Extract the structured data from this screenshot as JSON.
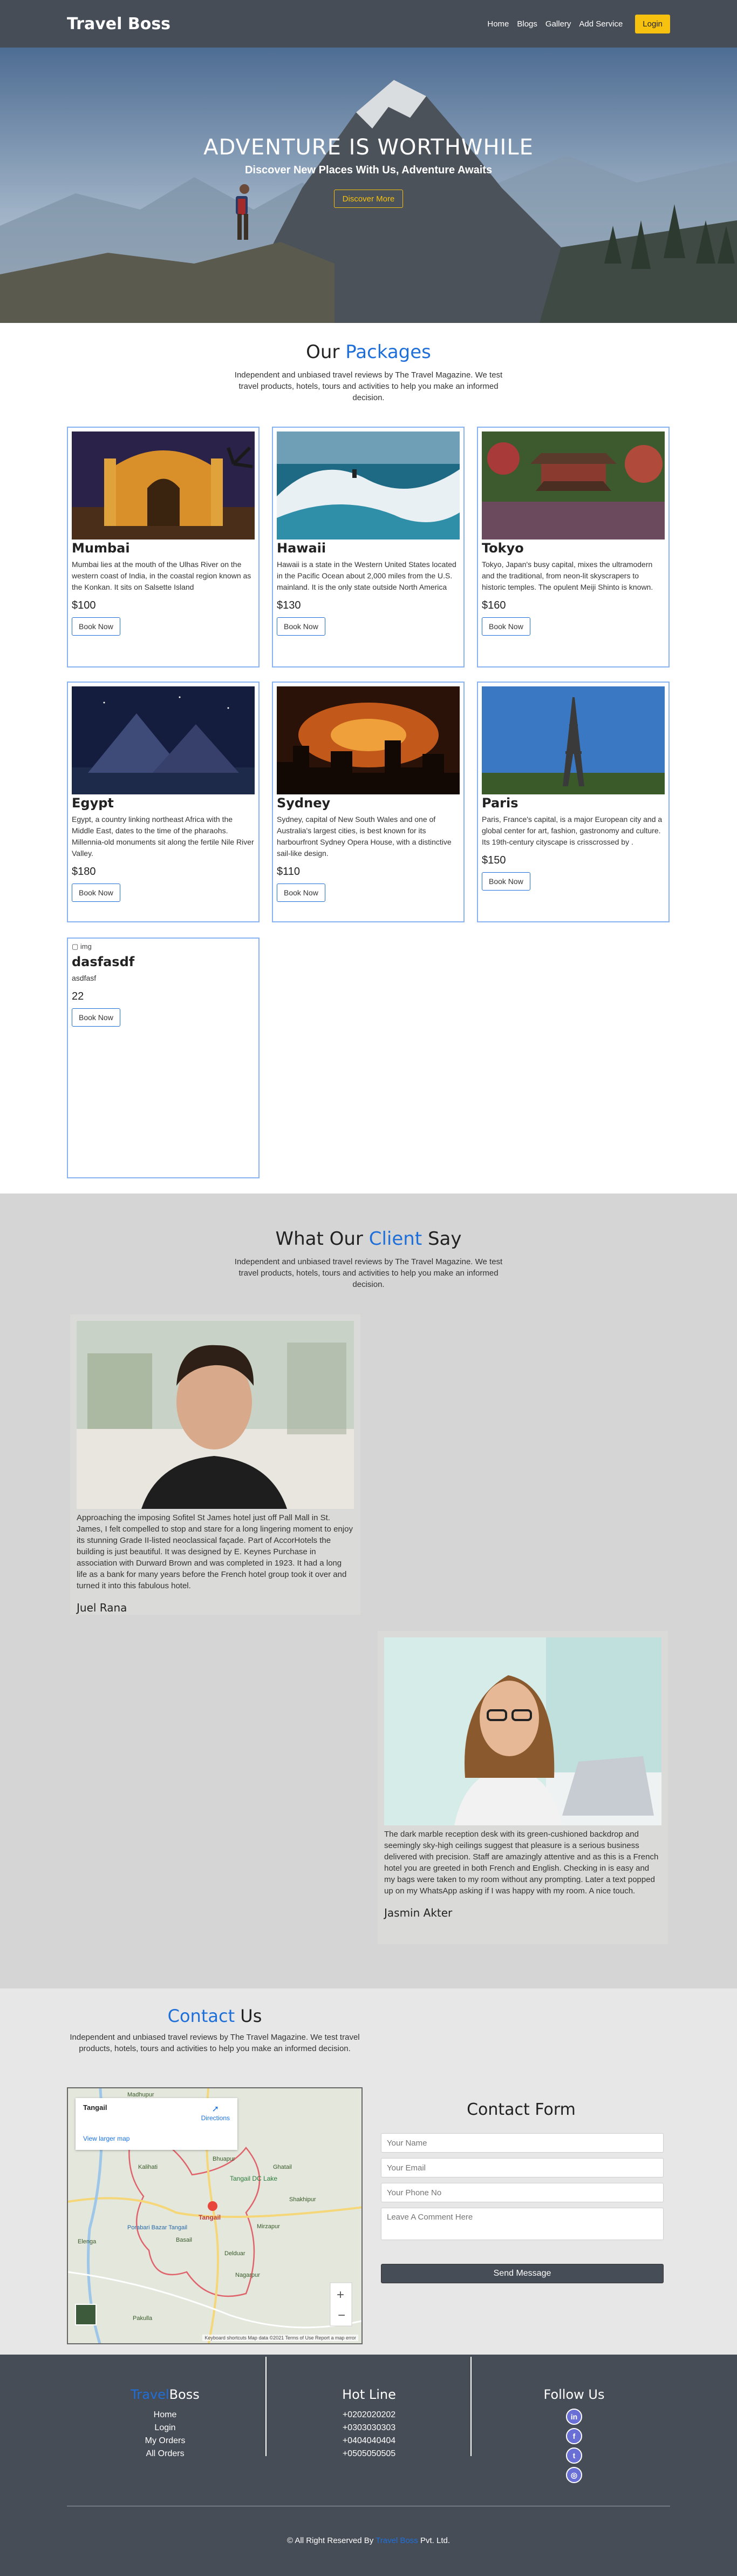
{
  "nav": {
    "brand": "Travel Boss",
    "links": [
      "Home",
      "Blogs",
      "Gallery",
      "Add Service"
    ],
    "login": "Login"
  },
  "hero": {
    "title": "ADVENTURE IS WORTHWHILE",
    "subtitle": "Discover New Places With Us, Adventure Awaits",
    "button": "Discover More"
  },
  "packages": {
    "title_prefix": "Our",
    "title_accent": "Packages",
    "intro": "Independent and unbiased travel reviews by The Travel Magazine. We test travel products, hotels, tours and activities to help you make an informed decision.",
    "cards": [
      {
        "name": "Mumbai",
        "desc": "Mumbai lies at the mouth of the Ulhas River on the western coast of India, in the coastal region known as the Konkan. It sits on Salsette Island",
        "price": "$100",
        "button": "Book Now"
      },
      {
        "name": "Hawaii",
        "desc": "Hawaii is a state in the Western United States located in the Pacific Ocean about 2,000 miles from the U.S. mainland. It is the only state outside North America",
        "price": "$130",
        "button": "Book Now"
      },
      {
        "name": "Tokyo",
        "desc": "Tokyo, Japan's busy capital, mixes the ultramodern and the traditional, from neon-lit skyscrapers to historic temples. The opulent Meiji Shinto is known.",
        "price": "$160",
        "button": "Book Now"
      },
      {
        "name": "Egypt",
        "desc": "Egypt, a country linking northeast Africa with the Middle East, dates to the time of the pharaohs. Millennia-old monuments sit along the fertile Nile River Valley.",
        "price": "$180",
        "button": "Book Now"
      },
      {
        "name": "Sydney",
        "desc": "Sydney, capital of New South Wales and one of Australia's largest cities, is best known for its harbourfront Sydney Opera House, with a distinctive sail-like design.",
        "price": "$110",
        "button": "Book Now"
      },
      {
        "name": "Paris",
        "desc": "Paris, France's capital, is a major European city and a global center for art, fashion, gastronomy and culture. Its 19th-century cityscape is crisscrossed by .",
        "price": "$150",
        "button": "Book Now"
      },
      {
        "name": "dasfasdf",
        "desc": "asdfasf",
        "price": "22",
        "button": "Book Now",
        "img_alt": "img"
      }
    ]
  },
  "testimonials": {
    "title_prefix": "What Our",
    "title_accent": "Client",
    "title_suffix": "Say",
    "intro": "Independent and unbiased travel reviews by The Travel Magazine. We test travel products, hotels, tours and activities to help you make an informed decision.",
    "items": [
      {
        "text": "Approaching the imposing Sofitel St James hotel just off Pall Mall in St. James, I felt compelled to stop and stare for a long lingering moment to enjoy its stunning Grade II-listed neoclassical façade. Part of AccorHotels the building is just beautiful. It was designed by E. Keynes Purchase in association with Durward Brown and was completed in 1923. It had a long life as a bank for many years before the French hotel group took it over and turned it into this fabulous hotel.",
        "name": "Juel Rana"
      },
      {
        "text": "The dark marble reception desk with its green-cushioned backdrop and seemingly sky-high ceilings suggest that pleasure is a serious business delivered with precision. Staff are amazingly attentive and as this is a French hotel you are greeted in both French and English. Checking in is easy and my bags were taken to my room without any prompting. Later a text popped up on my WhatsApp asking if I was happy with my room. A nice touch.",
        "name": "Jasmin Akter"
      }
    ]
  },
  "contact": {
    "title_accent": "Contact",
    "title_suffix": "Us",
    "intro": "Independent and unbiased travel reviews by The Travel Magazine. We test travel products, hotels, tours and activities to help you make an informed decision.",
    "map": {
      "place": "Tangail",
      "directions": "Directions",
      "larger": "View larger map",
      "labels": [
        "Tangail",
        "Bhuapur",
        "Ghatail",
        "Tangail DC Lake",
        "Shakhipur",
        "Mirzapur",
        "Basail",
        "Delduar",
        "Nagarpur",
        "Porabari Bazar Tangail",
        "Elenga",
        "Kalihati",
        "Pakulla",
        "Madhupur"
      ],
      "footer": "Keyboard shortcuts  Map data ©2021  Terms of Use  Report a map error"
    },
    "form": {
      "title": "Contact Form",
      "name_placeholder": "Your Name",
      "email_placeholder": "Your Email",
      "phone_placeholder": "Your Phone No",
      "comment_placeholder": "Leave A Comment Here",
      "send": "Send Message"
    }
  },
  "footer": {
    "brand_accent": "Travel",
    "brand_rest": "Boss",
    "links": [
      "Home",
      "Login",
      "My Orders",
      "All Orders"
    ],
    "hotline_title": "Hot Line",
    "hotlines": [
      "+0202020202",
      "+0303030303",
      "+0404040404",
      "+0505050505"
    ],
    "follow_title": "Follow Us",
    "social_icons": [
      "linkedin-icon",
      "facebook-icon",
      "twitter-icon",
      "instagram-icon"
    ],
    "copyright_prefix": "© All Right Reserved By",
    "copyright_brand": "Travel Boss",
    "copyright_suffix": "Pvt. Ltd."
  }
}
